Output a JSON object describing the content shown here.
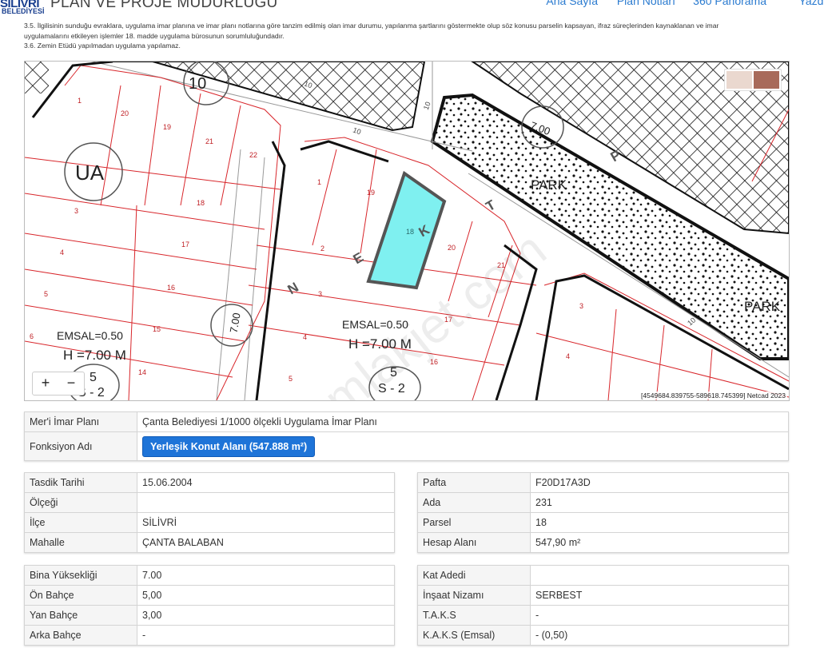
{
  "header": {
    "logo_line1": "SİLİVRİ",
    "logo_line2": "BELEDİYESİ",
    "title": "PLAN VE PROJE MÜDÜRLÜĞÜ",
    "nav": [
      "Ana Sayfa",
      "Plan Notları",
      "360 Panorama",
      "Yazdır"
    ]
  },
  "notes": [
    "3.5. İlgilisinin sunduğu evraklara, uygulama imar planına ve imar planı notlarına göre tanzim edilmiş olan imar durumu, yapılanma şartlarını göstermekte olup söz konusu parselin kapsayan, ifraz süreçlerinden kaynaklanan ve imar",
    "uygulamalarını etkileyen işlemler 18. madde uygulama bürosunun sorumluluğundadır.",
    "3.6. Zemin Etüdü yapılmadan uygulama yapılamaz."
  ],
  "map": {
    "labels": {
      "ua": "UA",
      "park1": "PARK",
      "park2": "PARK",
      "emsal_left": "EMSAL=0.50",
      "h_left": "H =7.00 M",
      "emsal_mid": "EMSAL=0.50",
      "h_mid": "H =7.00 M",
      "road_10": "10",
      "road_7": "7.00",
      "road_7b": "7.00",
      "s_left_n": "5",
      "s_left": "S - 2",
      "s_mid_n": "5",
      "s_mid": "S - 2",
      "street_letters": [
        "N",
        "E",
        "K",
        "T",
        "P"
      ],
      "watermark": "emlakjet.com",
      "parcels_left": [
        "1",
        "20",
        "19",
        "21",
        "22",
        "3",
        "18",
        "4",
        "17",
        "5",
        "16",
        "6",
        "15",
        "14"
      ],
      "parcels_mid": [
        "1",
        "19",
        "18",
        "2",
        "20",
        "21",
        "3",
        "17",
        "4",
        "16",
        "5"
      ],
      "parcels_right": [
        "3",
        "4"
      ],
      "contour_labels": [
        "10",
        "10",
        "10",
        "10"
      ]
    },
    "zoom_in": "+",
    "zoom_out": "−",
    "attribution": "[4549684.839755-589618.745399] Netcad 2023"
  },
  "plan_table": [
    {
      "label": "Mer'i İmar Planı",
      "value": "Çanta Belediyesi 1/1000 ölçekli Uygulama İmar Planı"
    },
    {
      "label": "Fonksiyon Adı",
      "value": "Yerleşik Konut Alanı (547.888 m²)"
    }
  ],
  "left_table_1": [
    {
      "label": "Tasdik Tarihi",
      "value": "15.06.2004"
    },
    {
      "label": "Ölçeği",
      "value": ""
    },
    {
      "label": "İlçe",
      "value": "SİLİVRİ"
    },
    {
      "label": "Mahalle",
      "value": "ÇANTA BALABAN"
    }
  ],
  "right_table_1": [
    {
      "label": "Pafta",
      "value": "F20D17A3D"
    },
    {
      "label": "Ada",
      "value": "231"
    },
    {
      "label": "Parsel",
      "value": "18"
    },
    {
      "label": "Hesap Alanı",
      "value": "547,90 m²"
    }
  ],
  "left_table_2": [
    {
      "label": "Bina Yüksekliği",
      "value": "7.00"
    },
    {
      "label": "Ön Bahçe",
      "value": "5,00"
    },
    {
      "label": "Yan Bahçe",
      "value": "3,00"
    },
    {
      "label": "Arka Bahçe",
      "value": "-"
    }
  ],
  "right_table_2": [
    {
      "label": "Kat Adedi",
      "value": ""
    },
    {
      "label": "İnşaat Nizamı",
      "value": "SERBEST"
    },
    {
      "label": "T.A.K.S",
      "value": "-"
    },
    {
      "label": "K.A.K.S (Emsal)",
      "value": "- (0,50)"
    }
  ],
  "colors": {
    "accent": "#1e74d8",
    "parcel_line": "#d8262b",
    "highlight": "#7ff0f0",
    "nav_link": "#2b7bd0"
  }
}
